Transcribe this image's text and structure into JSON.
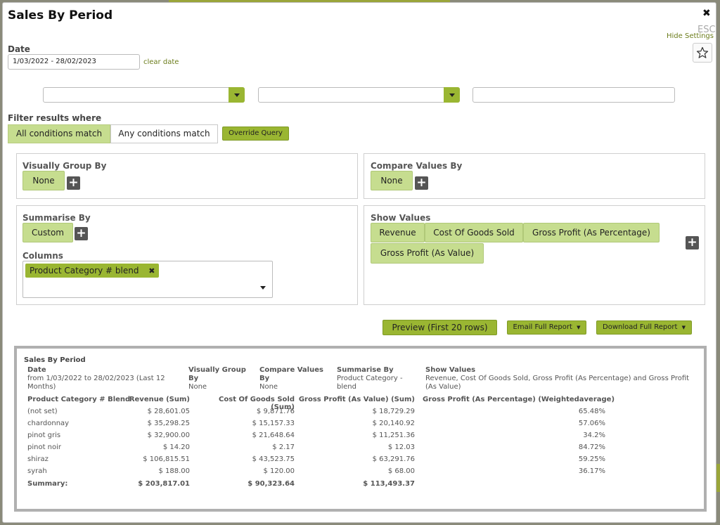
{
  "title": "Sales By Period",
  "esc_label": "ESC",
  "hide_settings": "Hide Settings",
  "date": {
    "label": "Date",
    "value": "1/03/2022 - 28/02/2023",
    "clear": "clear date"
  },
  "filter": {
    "label": "Filter results where",
    "all": "All conditions match",
    "any": "Any conditions match",
    "override": "Override Query"
  },
  "visually_group": {
    "title": "Visually Group By",
    "value": "None"
  },
  "compare": {
    "title": "Compare Values By",
    "value": "None"
  },
  "summarise": {
    "title": "Summarise By",
    "value": "Custom"
  },
  "columns": {
    "title": "Columns",
    "tag": "Product Category # blend"
  },
  "show_values": {
    "title": "Show Values",
    "items": [
      "Revenue",
      "Cost Of Goods Sold",
      "Gross Profit (As Percentage)",
      "Gross Profit (As Value)"
    ]
  },
  "actions": {
    "preview": "Preview (First 20 rows)",
    "email": "Email Full Report",
    "download": "Download Full Report"
  },
  "report": {
    "title": "Sales By Period",
    "meta": {
      "date_h": "Date",
      "date_v": "from 1/03/2022 to 28/02/2023 (Last 12 Months)",
      "vg_h": "Visually Group By",
      "vg_v": "None",
      "cv_h": "Compare Values By",
      "cv_v": "None",
      "sb_h": "Summarise By",
      "sb_v": "Product Category - blend",
      "sv_h": "Show Values",
      "sv_v": "Revenue, Cost Of Goods Sold, Gross Profit (As Percentage) and Gross Profit (As Value)"
    },
    "headers": [
      "Product Category # Blend",
      "Revenue (Sum)",
      "Cost Of Goods Sold (Sum)",
      "Gross Profit (As Value) (Sum)",
      "Gross Profit (As Percentage) (Weightedaverage)"
    ],
    "rows": [
      [
        "(not set)",
        "$ 28,601.05",
        "$ 9,871.76",
        "$ 18,729.29",
        "65.48%"
      ],
      [
        "chardonnay",
        "$ 35,298.25",
        "$ 15,157.33",
        "$ 20,140.92",
        "57.06%"
      ],
      [
        "pinot gris",
        "$ 32,900.00",
        "$ 21,648.64",
        "$ 11,251.36",
        "34.2%"
      ],
      [
        "pinot noir",
        "$ 14.20",
        "$ 2.17",
        "$ 12.03",
        "84.72%"
      ],
      [
        "shiraz",
        "$ 106,815.51",
        "$ 43,523.75",
        "$ 63,291.76",
        "59.25%"
      ],
      [
        "syrah",
        "$ 188.00",
        "$ 120.00",
        "$ 68.00",
        "36.17%"
      ]
    ],
    "summary": [
      "Summary:",
      "$ 203,817.01",
      "$ 90,323.64",
      "$ 113,493.37",
      ""
    ]
  },
  "colors": {
    "accent": "#9ab632",
    "chip": "#c6dd8f",
    "link": "#6c7d1c"
  }
}
